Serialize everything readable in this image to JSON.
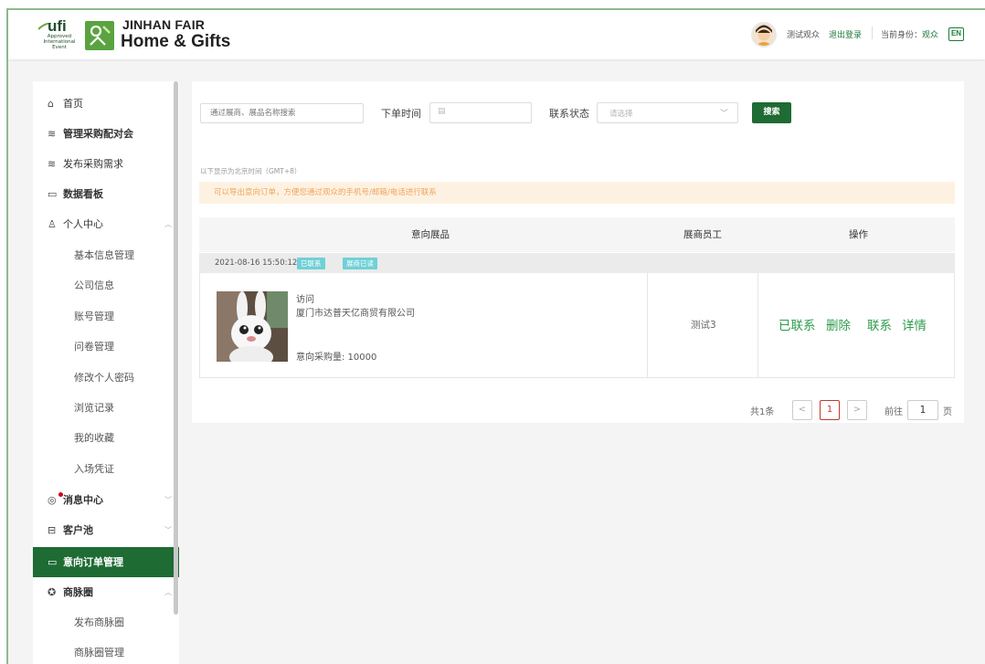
{
  "header": {
    "ufi_text": "ufi",
    "ufi_sub": "Approved International Event",
    "brand_top": "JINHAN FAIR",
    "brand_bottom": "Home & Gifts",
    "user_name": "测试观众",
    "logout": "退出登录",
    "role_label": "当前身份：",
    "role": "观众",
    "lang": "EN"
  },
  "sidebar": {
    "items": [
      {
        "icon": "home-icon",
        "glyph": "⌂",
        "label": "首页"
      },
      {
        "icon": "database-icon",
        "glyph": "≋",
        "label": "管理采购配对会"
      },
      {
        "icon": "database-icon",
        "glyph": "≋",
        "label": "发布采购需求"
      },
      {
        "icon": "dashboard-icon",
        "glyph": "▭",
        "label": "数据看板"
      },
      {
        "icon": "user-icon",
        "glyph": "♙",
        "label": "个人中心"
      },
      {
        "label": "基本信息管理"
      },
      {
        "label": "公司信息"
      },
      {
        "label": "账号管理"
      },
      {
        "label": "问卷管理"
      },
      {
        "label": "修改个人密码"
      },
      {
        "label": "浏览记录"
      },
      {
        "label": "我的收藏"
      },
      {
        "label": "入场凭证"
      },
      {
        "icon": "message-icon",
        "glyph": "◎",
        "label": "消息中心"
      },
      {
        "icon": "inbox-icon",
        "glyph": "⊟",
        "label": "客户池"
      },
      {
        "icon": "order-icon",
        "glyph": "▭",
        "label": "意向订单管理"
      },
      {
        "icon": "network-icon",
        "glyph": "✪",
        "label": "商脉圈"
      },
      {
        "label": "发布商脉圈"
      },
      {
        "label": "商脉圈管理"
      }
    ]
  },
  "filters": {
    "search_placeholder": "通过展商、展品名称搜索",
    "order_time_label": "下单时间",
    "contact_status_label": "联系状态",
    "select_placeholder": "请选择",
    "search_button": "搜索"
  },
  "timezone_note": "以下显示为北京时间（GMT+8）",
  "tip": "可以导出意向订单，方便您通过观众的手机号/邮箱/电话进行联系",
  "table": {
    "headers": [
      "意向展品",
      "展商员工",
      "操作"
    ],
    "groups": [
      {
        "timestamp": "2021-08-16 15:50:12",
        "badges": [
          "已联系",
          "展商已读"
        ],
        "product_type": "访问",
        "company": "厦门市达普天亿商贸有限公司",
        "quantity": "意向采购量: 10000",
        "staff": "测试3",
        "actions": [
          "已联系",
          "删除",
          "联系",
          "详情"
        ]
      }
    ]
  },
  "pagination": {
    "total": "共1条",
    "prev": "<",
    "current": "1",
    "next": ">",
    "goto_label": "前往",
    "goto_value": "1",
    "page_unit": "页"
  }
}
